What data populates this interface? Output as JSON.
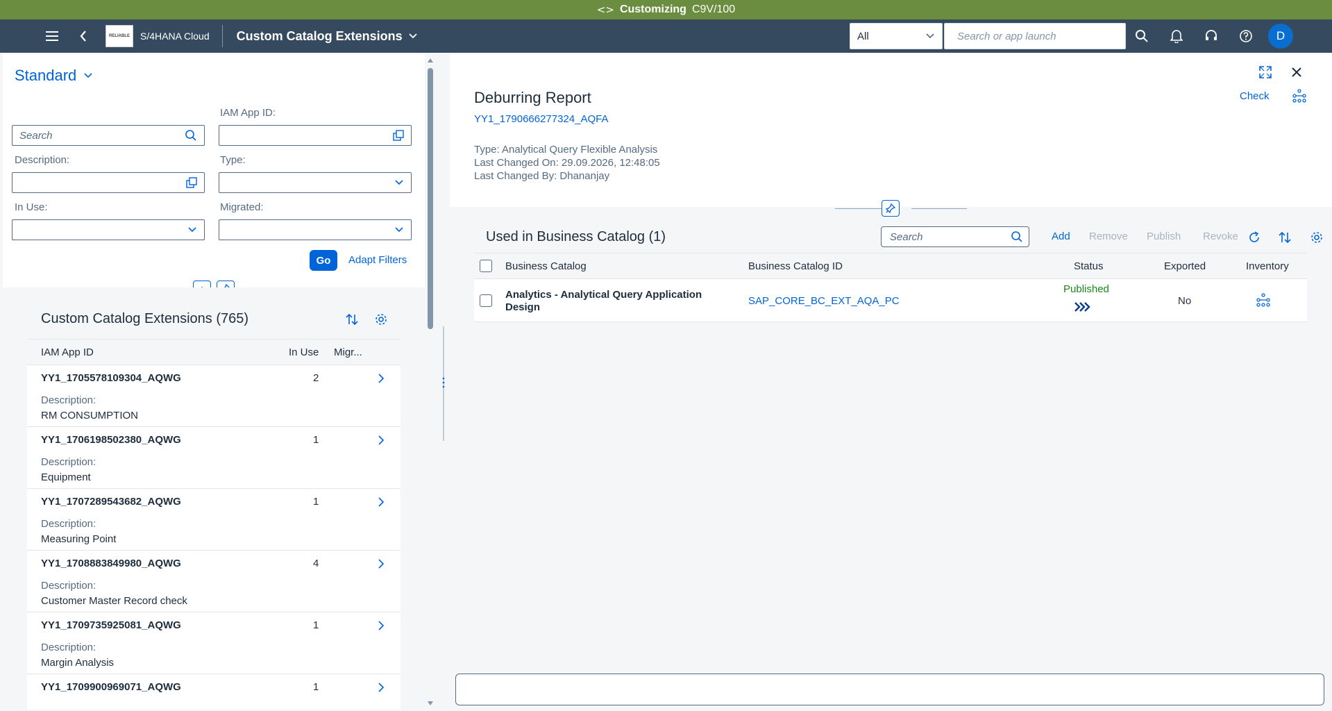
{
  "env": {
    "label": "Customizing",
    "system": "C9V/100"
  },
  "shell": {
    "product": "S/4HANA Cloud",
    "app_title": "Custom Catalog Extensions",
    "scope": "All",
    "search_placeholder": "Search or app launch",
    "avatar": "D",
    "logo_text": "RELIABLE"
  },
  "filters": {
    "variant": "Standard",
    "search_placeholder": "Search",
    "iam_label": "IAM App ID:",
    "description_label": "Description:",
    "type_label": "Type:",
    "inuse_label": "In Use:",
    "migrated_label": "Migrated:",
    "go": "Go",
    "adapt": "Adapt Filters"
  },
  "list": {
    "title": "Custom Catalog Extensions (765)",
    "col_id": "IAM App ID",
    "col_inuse": "In Use",
    "col_migrated": "Migr...",
    "desc_label": "Description:",
    "rows": [
      {
        "id": "YY1_1705578109304_AQWG",
        "inuse": "2",
        "desc": "RM CONSUMPTION"
      },
      {
        "id": "YY1_1706198502380_AQWG",
        "inuse": "1",
        "desc": "Equipment"
      },
      {
        "id": "YY1_1707289543682_AQWG",
        "inuse": "1",
        "desc": "Measuring Point"
      },
      {
        "id": "YY1_1708883849980_AQWG",
        "inuse": "4",
        "desc": "Customer Master Record check"
      },
      {
        "id": "YY1_1709735925081_AQWG",
        "inuse": "1",
        "desc": "Margin Analysis"
      },
      {
        "id": "YY1_1709900969071_AQWG",
        "inuse": "1",
        "desc": ""
      }
    ]
  },
  "detail": {
    "title": "Deburring Report",
    "subtitle": "YY1_1790666277324_AQFA",
    "type": "Type: Analytical Query Flexible Analysis",
    "changed_on": "Last Changed On: 29.09.2026, 12:48:05",
    "changed_by": "Last Changed By: Dhananjay",
    "check": "Check"
  },
  "catalog": {
    "title": "Used in Business Catalog (1)",
    "search_placeholder": "Search",
    "add": "Add",
    "remove": "Remove",
    "publish": "Publish",
    "revoke": "Revoke",
    "col_catalog": "Business Catalog",
    "col_catalog_id": "Business Catalog ID",
    "col_status": "Status",
    "col_exported": "Exported",
    "col_inventory": "Inventory",
    "rows": [
      {
        "name_line1": "Analytics - Analytical Query Application",
        "name_line2": "Design",
        "catalog_id": "SAP_CORE_BC_EXT_AQA_PC",
        "status": "Published",
        "exported": "No"
      }
    ]
  },
  "colors": {
    "shell": "#354a5f",
    "env": "#6a8d3f",
    "accent": "#0064d9",
    "positive": "#188918"
  }
}
